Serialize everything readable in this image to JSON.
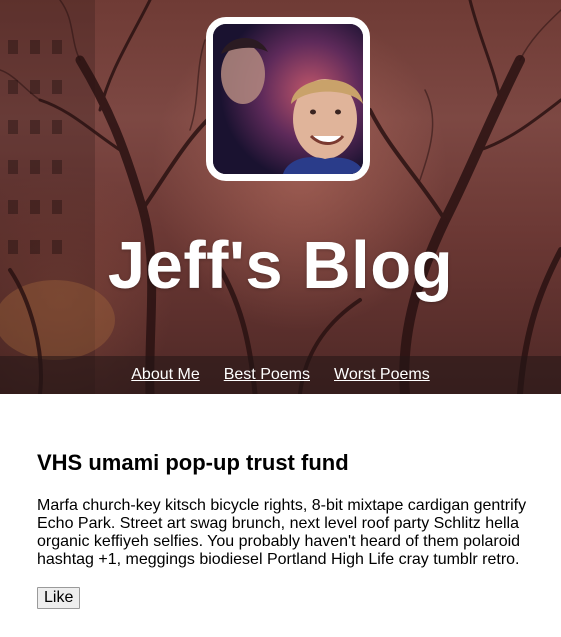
{
  "header": {
    "title": "Jeff's Blog"
  },
  "nav": {
    "items": [
      {
        "label": "About Me"
      },
      {
        "label": "Best Poems"
      },
      {
        "label": "Worst Poems"
      }
    ]
  },
  "post": {
    "title": "VHS umami pop-up trust fund",
    "body": "Marfa church-key kitsch bicycle rights, 8-bit mixtape cardigan gentrify Echo Park. Street art swag brunch, next level roof party Schlitz hella organic keffiyeh selfies. You probably haven't heard of them polaroid hashtag +1, meggings biodiesel Portland High Life cray tumblr retro.",
    "like_label": "Like"
  }
}
